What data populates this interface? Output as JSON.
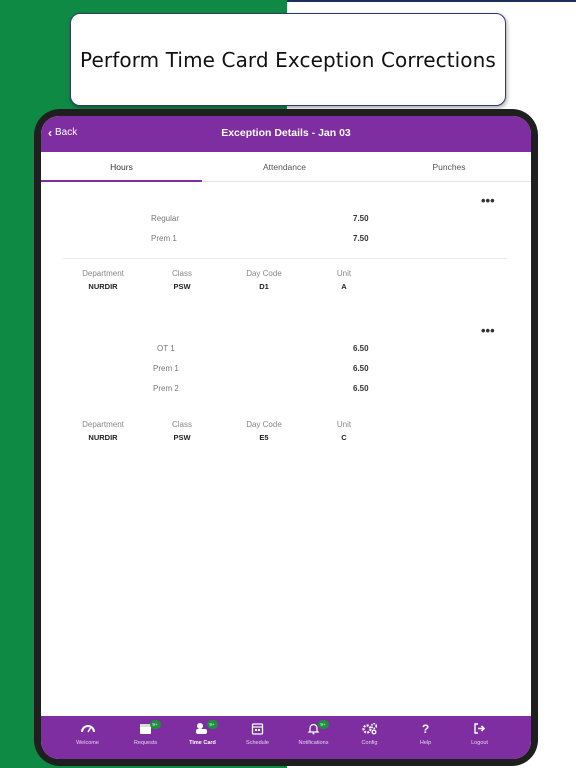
{
  "slide": {
    "title": "Perform Time Card Exception Corrections",
    "colors": {
      "green": "#0e8a44",
      "purple": "#7e2ea0",
      "tablet": "#1f1f1f"
    }
  },
  "header": {
    "back_label": "Back",
    "back_icon": "chevron-left-icon",
    "title": "Exception Details - Jan 03"
  },
  "tabs": [
    {
      "label": "Hours",
      "active": true
    },
    {
      "label": "Attendance",
      "active": false
    },
    {
      "label": "Punches",
      "active": false
    }
  ],
  "entries": [
    {
      "hours": [
        {
          "label": "Regular",
          "value": "7.50"
        },
        {
          "label": "Prem 1",
          "value": "7.50"
        }
      ],
      "meta_labels": [
        "Department",
        "Class",
        "Day Code",
        "Unit"
      ],
      "meta_values": [
        "NURDIR",
        "PSW",
        "D1",
        "A"
      ],
      "more": "•••"
    },
    {
      "hours": [
        {
          "label": "OT 1",
          "value": "6.50"
        },
        {
          "label": "Prem 1",
          "value": "6.50"
        },
        {
          "label": "Prem 2",
          "value": "6.50"
        }
      ],
      "meta_labels": [
        "Department",
        "Class",
        "Day Code",
        "Unit"
      ],
      "meta_values": [
        "NURDIR",
        "PSW",
        "E5",
        "C"
      ],
      "more": "•••"
    }
  ],
  "nav": [
    {
      "label": "Welcome",
      "icon": "dashboard-icon",
      "badge": ""
    },
    {
      "label": "Requests",
      "icon": "calendar-request-icon",
      "badge": "9+"
    },
    {
      "label": "Time Card",
      "icon": "time-card-icon",
      "badge": "9+",
      "active": true
    },
    {
      "label": "Schedule",
      "icon": "schedule-icon",
      "badge": ""
    },
    {
      "label": "Notifications",
      "icon": "bell-icon",
      "badge": "9+"
    },
    {
      "label": "Config",
      "icon": "gears-icon",
      "badge": ""
    },
    {
      "label": "Help",
      "icon": "help-icon",
      "badge": ""
    },
    {
      "label": "Logout",
      "icon": "logout-icon",
      "badge": ""
    }
  ]
}
